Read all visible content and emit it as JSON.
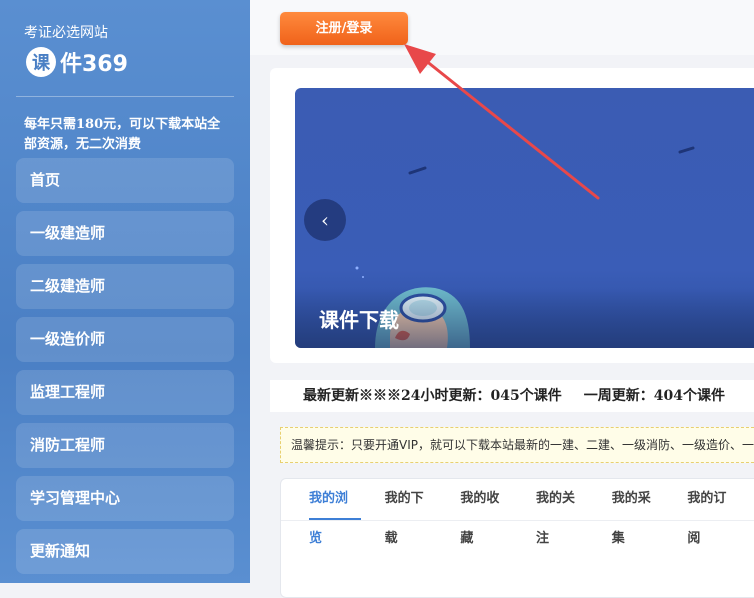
{
  "sidebar": {
    "tagline": "考证必选网站",
    "logo_mark": "课",
    "logo_text": "件369",
    "promo": "每年只需180元，可以下载本站全部资源，无二次消费",
    "items": [
      {
        "label": "首页"
      },
      {
        "label": "一级建造师"
      },
      {
        "label": "二级建造师"
      },
      {
        "label": "一级造价师"
      },
      {
        "label": "监理工程师"
      },
      {
        "label": "消防工程师"
      },
      {
        "label": "学习管理中心"
      },
      {
        "label": "更新通知"
      }
    ]
  },
  "header": {
    "login_label": "注册/登录"
  },
  "carousel": {
    "prev_icon": "‹",
    "caption": "课件下载"
  },
  "stats": {
    "latest": "最新更新※※※",
    "day": "24小时更新：045个课件",
    "week": "一周更新：404个课件"
  },
  "notice": {
    "text": "温馨提示：只要开通VIP，就可以下载本站最新的一建、二建、一级消防、一级造价、一级监理"
  },
  "tabs": [
    {
      "label": "我的浏览"
    },
    {
      "label": "我的下载"
    },
    {
      "label": "我的收藏"
    },
    {
      "label": "我的关注"
    },
    {
      "label": "我的采集"
    },
    {
      "label": "我的订阅"
    }
  ],
  "colors": {
    "sidebar": "#4a7fc4",
    "accent": "#3e7fd6",
    "login_button": "#f0621a",
    "annotation_arrow": "#e8484a"
  }
}
